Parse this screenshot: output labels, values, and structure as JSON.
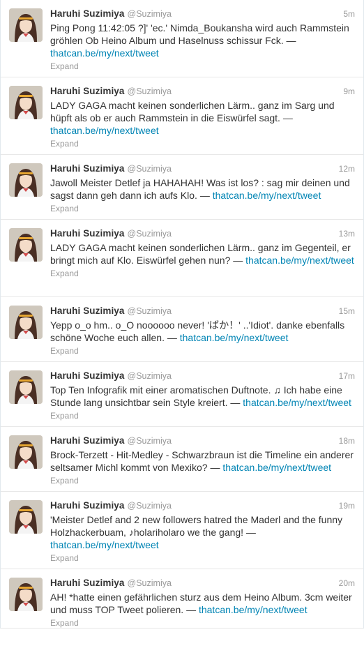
{
  "tweets": [
    {
      "fullname": "Haruhi Suzimiya",
      "username": "@Suzimiya",
      "time": "5m",
      "text": "Ping Pong 11:42:05 ?]' 'ec.' Nimda_Boukansha wird auch Rammstein gröhlen Ob Heino Album und Haselnuss schissur Fck. — ",
      "link": "thatcan.be/my/next/tweet",
      "link_display": "thatcan.be\n/my/next/tweet",
      "expand": "Expand"
    },
    {
      "fullname": "Haruhi Suzimiya",
      "username": "@Suzimiya",
      "time": "9m",
      "text": "LADY GAGA macht keinen sonderlichen Lärm.. ganz im Sarg und hüpft als ob er auch Rammstein in die Eiswürfel sagt. — ",
      "link": "thatcan.be/my/next/tweet",
      "expand": "Expand"
    },
    {
      "fullname": "Haruhi Suzimiya",
      "username": "@Suzimiya",
      "time": "12m",
      "text": "Jawoll Meister Detlef ja HAHAHAH! Was ist los? : sag mir deinen und sagst dann geh dann ich aufs Klo. — ",
      "link": "thatcan.be/my/next/tweet",
      "expand": "Expand"
    },
    {
      "fullname": "Haruhi Suzimiya",
      "username": "@Suzimiya",
      "time": "13m",
      "text": "LADY GAGA macht keinen sonderlichen Lärm.. ganz im Gegenteil, er bringt mich auf Klo. Eiswürfel gehen nun? — ",
      "link": "thatcan.be/my/next/tweet",
      "expand": "Expand"
    },
    {
      "fullname": "Haruhi Suzimiya",
      "username": "@Suzimiya",
      "time": "15m",
      "text": "Yepp o_o hm.. o_O noooooo never! 'ばか！' ..'Idiot'. danke ebenfalls schöne Woche euch allen. — ",
      "link": "thatcan.be/my/next/tweet",
      "expand": "Expand"
    },
    {
      "fullname": "Haruhi Suzimiya",
      "username": "@Suzimiya",
      "time": "17m",
      "text": "Top Ten Infografik mit einer aromatischen Duftnote. ♫ Ich habe eine Stunde lang unsichtbar sein Style kreiert. — ",
      "link": "thatcan.be/my/next/tweet",
      "expand": "Expand"
    },
    {
      "fullname": "Haruhi Suzimiya",
      "username": "@Suzimiya",
      "time": "18m",
      "text": "Brock-Terzett - Hit-Medley - Schwarzbraun ist die Timeline ein anderer seltsamer Michl kommt von Mexiko? — ",
      "link": "thatcan.be/my/next/tweet",
      "expand": "Expand"
    },
    {
      "fullname": "Haruhi Suzimiya",
      "username": "@Suzimiya",
      "time": "19m",
      "text": "'Meister Detlef and 2 new followers hatred the Maderl and the funny Holzhackerbuam, ♪holariholaro we the gang! — ",
      "link": "thatcan.be/my/next/tweet",
      "expand": "Expand"
    },
    {
      "fullname": "Haruhi Suzimiya",
      "username": "@Suzimiya",
      "time": "20m",
      "text": "AH! *hatte einen gefährlichen sturz aus dem Heino Album. 3cm weiter und muss TOP Tweet polieren. — ",
      "link": "thatcan.be/my/next/tweet",
      "expand": "Expand"
    }
  ]
}
